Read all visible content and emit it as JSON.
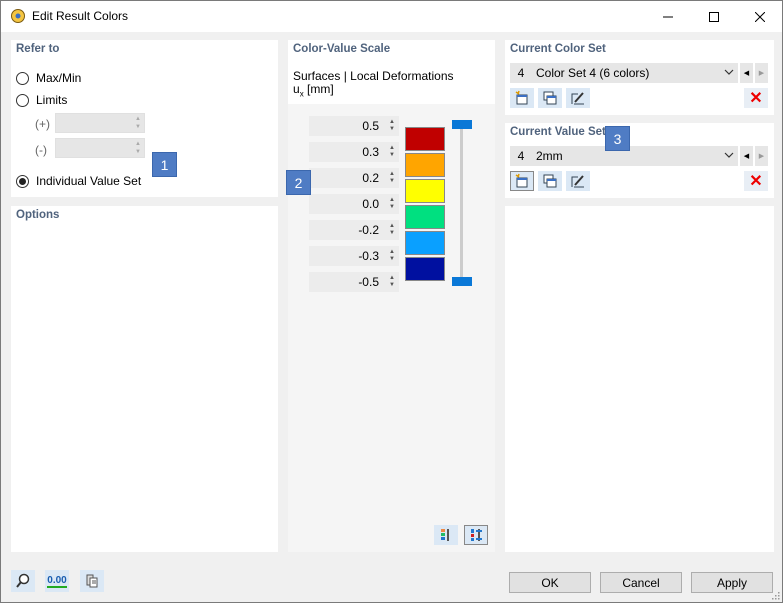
{
  "window": {
    "title": "Edit Result Colors",
    "minimize_icon": "minimize-icon",
    "maximize_icon": "maximize-icon",
    "close_icon": "close-icon"
  },
  "refer_to": {
    "title": "Refer to",
    "options": [
      {
        "label": "Max/Min",
        "checked": false
      },
      {
        "label": "Limits",
        "checked": false
      },
      {
        "label": "Individual Value Set",
        "checked": true
      }
    ],
    "plus_label": "(+)",
    "minus_label": "(-)"
  },
  "options_panel": {
    "title": "Options"
  },
  "scale": {
    "title": "Color-Value Scale",
    "subtitle": "Surfaces | Local Deformations",
    "unit_symbol": "u",
    "unit_subscript": "x",
    "unit": "[mm]",
    "values": [
      "0.5",
      "0.3",
      "0.2",
      "0.0",
      "-0.2",
      "-0.3",
      "-0.5"
    ],
    "colors": [
      "#c00000",
      "#ffa500",
      "#ffff00",
      "#00e080",
      "#0aa0ff",
      "#0010a0"
    ]
  },
  "color_set": {
    "title": "Current Color Set",
    "number": "4",
    "name": "Color Set 4 (6 colors)"
  },
  "value_set": {
    "title": "Current Value Set",
    "number": "4",
    "name": "2mm"
  },
  "badges": [
    "1",
    "2",
    "3"
  ],
  "footer": {
    "ok": "OK",
    "cancel": "Cancel",
    "apply": "Apply",
    "units_icon_text": "0.00"
  }
}
